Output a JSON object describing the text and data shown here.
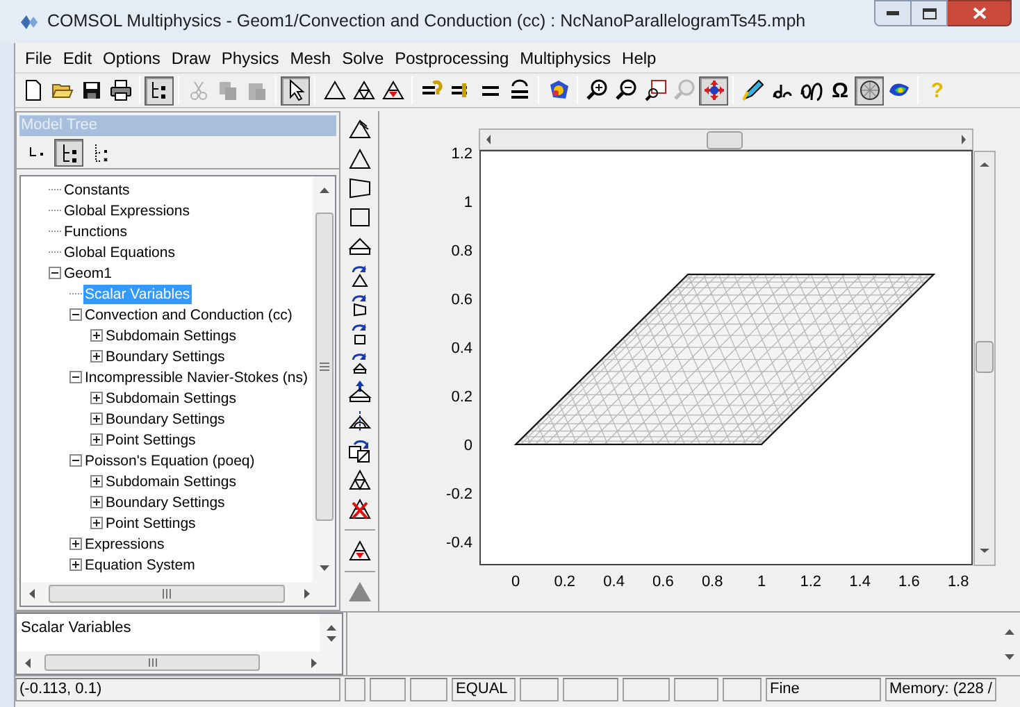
{
  "window": {
    "title": "COMSOL Multiphysics - Geom1/Convection and Conduction (cc) : NcNanoParallelogramTs45.mph"
  },
  "menu": [
    "File",
    "Edit",
    "Options",
    "Draw",
    "Physics",
    "Mesh",
    "Solve",
    "Postprocessing",
    "Multiphysics",
    "Help"
  ],
  "toolbar": [
    [
      {
        "selected": false,
        "disabled": false
      },
      {
        "selected": false,
        "disabled": false
      },
      {
        "selected": false,
        "disabled": false
      },
      {
        "selected": false,
        "disabled": false
      }
    ],
    [
      {
        "selected": true,
        "disabled": false
      }
    ],
    [
      {
        "selected": false,
        "disabled": true
      },
      {
        "selected": false,
        "disabled": true
      },
      {
        "selected": false,
        "disabled": true
      }
    ],
    [
      {
        "selected": true,
        "disabled": false
      }
    ],
    [
      {
        "selected": false,
        "disabled": false
      },
      {
        "selected": false,
        "disabled": false
      },
      {
        "selected": false,
        "disabled": false
      }
    ],
    [
      {
        "selected": false,
        "disabled": false
      },
      {
        "selected": false,
        "disabled": false
      },
      {
        "selected": false,
        "disabled": false
      },
      {
        "selected": false,
        "disabled": false
      }
    ],
    [
      {
        "selected": false,
        "disabled": false
      }
    ],
    [
      {
        "selected": false,
        "disabled": false
      },
      {
        "selected": false,
        "disabled": false
      },
      {
        "selected": false,
        "disabled": false
      },
      {
        "selected": false,
        "disabled": true
      },
      {
        "selected": true,
        "disabled": false
      }
    ],
    [
      {
        "selected": false,
        "disabled": false
      },
      {
        "selected": false,
        "disabled": false
      },
      {
        "selected": false,
        "disabled": false
      },
      {
        "selected": false,
        "disabled": false,
        "glyph": "Ω"
      },
      {
        "selected": true,
        "disabled": false
      },
      {
        "selected": false,
        "disabled": false
      }
    ],
    [
      {
        "selected": false,
        "disabled": false,
        "glyph": "?"
      }
    ]
  ],
  "model_tree": {
    "title": "Model Tree",
    "view_buttons": [
      {
        "selected": false
      },
      {
        "selected": true
      },
      {
        "selected": false
      }
    ],
    "items": [
      {
        "label": "Constants",
        "selected": false
      },
      {
        "label": "Global Expressions",
        "selected": false
      },
      {
        "label": "Functions",
        "selected": false
      },
      {
        "label": "Global Equations",
        "selected": false
      },
      {
        "label": "Geom1",
        "selected": false,
        "expanded": true,
        "children": [
          {
            "label": "Scalar Variables",
            "selected": true
          },
          {
            "label": "Convection and Conduction (cc)",
            "selected": false,
            "expanded": true,
            "children": [
              {
                "label": "Subdomain Settings",
                "selected": false,
                "expanded": false
              },
              {
                "label": "Boundary Settings",
                "selected": false,
                "expanded": false
              }
            ]
          },
          {
            "label": "Incompressible Navier-Stokes (ns)",
            "selected": false,
            "expanded": true,
            "children": [
              {
                "label": "Subdomain Settings",
                "selected": false,
                "expanded": false
              },
              {
                "label": "Boundary Settings",
                "selected": false,
                "expanded": false
              },
              {
                "label": "Point Settings",
                "selected": false,
                "expanded": false
              }
            ]
          },
          {
            "label": "Poisson's Equation (poeq)",
            "selected": false,
            "expanded": true,
            "children": [
              {
                "label": "Subdomain Settings",
                "selected": false,
                "expanded": false
              },
              {
                "label": "Boundary Settings",
                "selected": false,
                "expanded": false
              },
              {
                "label": "Point Settings",
                "selected": false,
                "expanded": false
              }
            ]
          },
          {
            "label": "Expressions",
            "selected": false,
            "expanded": false
          },
          {
            "label": "Equation System",
            "selected": false,
            "expanded": false
          }
        ]
      }
    ]
  },
  "info_pane": {
    "text": "Scalar Variables"
  },
  "plot": {
    "x_tick_labels": [
      "0",
      "0.2",
      "0.4",
      "0.6",
      "0.8",
      "1",
      "1.2",
      "1.4",
      "1.6",
      "1.8"
    ],
    "y_tick_labels": [
      "1.2",
      "1",
      "0.8",
      "0.6",
      "0.4",
      "0.2",
      "0",
      "-0.2",
      "-0.4"
    ]
  },
  "status_bar": [
    {
      "kind": "text",
      "text": "(-0.113, 0.1)"
    },
    {
      "kind": "empty"
    },
    {
      "kind": "empty"
    },
    {
      "kind": "empty"
    },
    {
      "kind": "text",
      "text": "EQUAL"
    },
    {
      "kind": "empty"
    },
    {
      "kind": "empty"
    },
    {
      "kind": "empty"
    },
    {
      "kind": "empty"
    },
    {
      "kind": "empty"
    },
    {
      "kind": "text",
      "text": "Fine"
    },
    {
      "kind": "text",
      "text": "Memory: (228 /"
    }
  ]
}
